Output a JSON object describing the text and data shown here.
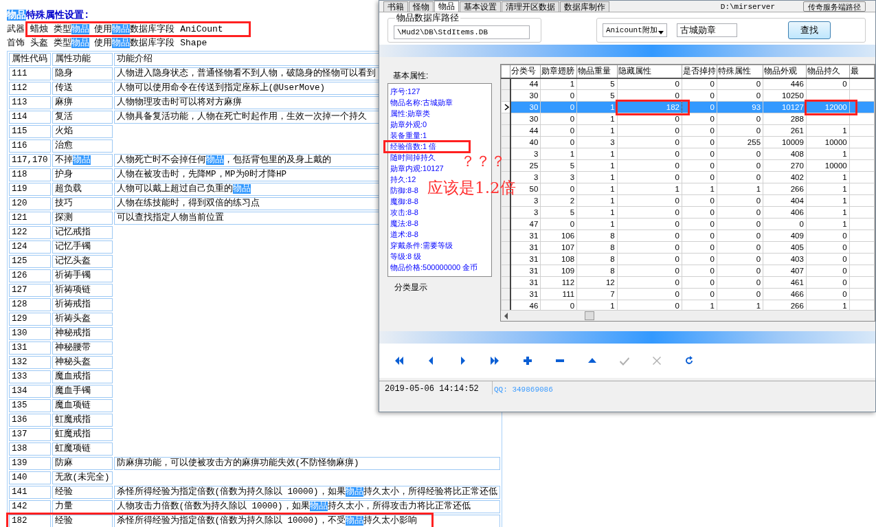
{
  "document": {
    "title": [
      {
        "text": "物品",
        "highlight": true
      },
      {
        "text": "特殊属性设置:"
      }
    ],
    "lines": [
      [
        {
          "text": "武器 蜡烛 类型"
        },
        {
          "text": "物品",
          "highlight": true
        },
        {
          "text": " 使用"
        },
        {
          "text": "物品",
          "highlight": true
        },
        {
          "text": "数据库字段 AniCount"
        }
      ],
      [
        {
          "text": "首饰 头盔 类型"
        },
        {
          "text": "物品",
          "highlight": true
        },
        {
          "text": " 使用"
        },
        {
          "text": "物品",
          "highlight": true
        },
        {
          "text": "数据库字段 Shape"
        }
      ]
    ],
    "table": {
      "columns": [
        "属性代码",
        "属性功能",
        "功能介绍"
      ],
      "rows": [
        {
          "code": "111",
          "function": [
            {
              "text": "隐身"
            }
          ],
          "description": [
            {
              "text": "人物进入隐身状态，普通怪物看不到人物，破隐身的怪物可以看到"
            }
          ]
        },
        {
          "code": "112",
          "function": [
            {
              "text": "传送"
            }
          ],
          "description": [
            {
              "text": "人物可以使用命令在传送到指定座标上(@UserMove)"
            }
          ]
        },
        {
          "code": "113",
          "function": [
            {
              "text": "麻痹"
            }
          ],
          "description": [
            {
              "text": "人物物理攻击时可以将对方麻痹"
            }
          ]
        },
        {
          "code": "114",
          "function": [
            {
              "text": "复活"
            }
          ],
          "description": [
            {
              "text": "人物具备复活功能，人物在死亡时起作用，生效一次掉一个持久"
            }
          ]
        },
        {
          "code": "115",
          "function": [
            {
              "text": "火焰"
            }
          ]
        },
        {
          "code": "116",
          "function": [
            {
              "text": "治愈"
            }
          ]
        },
        {
          "code": "117,170",
          "function": [
            {
              "text": "不掉"
            },
            {
              "text": "物品",
              "highlight": true
            }
          ],
          "description": [
            {
              "text": "人物死亡时不会掉任何"
            },
            {
              "text": "物品",
              "highlight": true
            },
            {
              "text": "，包括背包里的及身上戴的"
            }
          ]
        },
        {
          "code": "118",
          "function": [
            {
              "text": "护身"
            }
          ],
          "description": [
            {
              "text": "人物在被攻击时，先降MP，MP为0时才降HP"
            }
          ]
        },
        {
          "code": "119",
          "function": [
            {
              "text": "超负载"
            }
          ],
          "description": [
            {
              "text": "人物可以戴上超过自己负重的"
            },
            {
              "text": "物品",
              "highlight": true
            }
          ]
        },
        {
          "code": "120",
          "function": [
            {
              "text": "技巧"
            }
          ],
          "description": [
            {
              "text": "人物在练技能时，得到双倍的练习点"
            }
          ]
        },
        {
          "code": "121",
          "function": [
            {
              "text": "探测"
            }
          ],
          "description": [
            {
              "text": "可以查找指定人物当前位置"
            }
          ]
        },
        {
          "code": "122",
          "function": [
            {
              "text": "记忆戒指"
            }
          ]
        },
        {
          "code": "124",
          "function": [
            {
              "text": "记忆手镯"
            }
          ]
        },
        {
          "code": "125",
          "function": [
            {
              "text": "记忆头盔"
            }
          ]
        },
        {
          "code": "126",
          "function": [
            {
              "text": "祈祷手镯"
            }
          ]
        },
        {
          "code": "127",
          "function": [
            {
              "text": "祈祷项链"
            }
          ]
        },
        {
          "code": "128",
          "function": [
            {
              "text": "祈祷戒指"
            }
          ]
        },
        {
          "code": "129",
          "function": [
            {
              "text": "祈祷头盔"
            }
          ]
        },
        {
          "code": "130",
          "function": [
            {
              "text": "神秘戒指"
            }
          ]
        },
        {
          "code": "131",
          "function": [
            {
              "text": "神秘腰带"
            }
          ]
        },
        {
          "code": "132",
          "function": [
            {
              "text": "神秘头盔"
            }
          ]
        },
        {
          "code": "133",
          "function": [
            {
              "text": "魔血戒指"
            }
          ]
        },
        {
          "code": "134",
          "function": [
            {
              "text": "魔血手镯"
            }
          ]
        },
        {
          "code": "135",
          "function": [
            {
              "text": "魔血项链"
            }
          ]
        },
        {
          "code": "136",
          "function": [
            {
              "text": "虹魔戒指"
            }
          ]
        },
        {
          "code": "137",
          "function": [
            {
              "text": "虹魔戒指"
            }
          ]
        },
        {
          "code": "138",
          "function": [
            {
              "text": "虹魔项链"
            }
          ]
        },
        {
          "code": "139",
          "function": [
            {
              "text": "防麻"
            }
          ],
          "description": [
            {
              "text": "防麻痹功能，可以使被攻击方的麻痹功能失效(不防怪物麻痹)"
            }
          ]
        },
        {
          "code": "140",
          "function": [
            {
              "text": "无敌(未完全)"
            }
          ]
        },
        {
          "code": "141",
          "function": [
            {
              "text": "经验"
            }
          ],
          "description": [
            {
              "text": "杀怪所得经验为指定倍数(倍数为持久除以 10000)，如果"
            },
            {
              "text": "物品",
              "highlight": true
            },
            {
              "text": "持久太小，所得经验将比正常还低"
            }
          ]
        },
        {
          "code": "142",
          "function": [
            {
              "text": "力量"
            }
          ],
          "description": [
            {
              "text": "人物攻击力倍数(倍数为持久除以 10000)，如果"
            },
            {
              "text": "物品",
              "highlight": true
            },
            {
              "text": "持久太小，所得攻击力将比正常还低"
            }
          ]
        },
        {
          "code": "182",
          "function": [
            {
              "text": "经验"
            }
          ],
          "description": [
            {
              "text": "杀怪所得经验为指定倍数(倍数为持久除以 10000)，不受"
            },
            {
              "text": "物品",
              "highlight": true
            },
            {
              "text": "持久太小影响"
            }
          ]
        }
      ]
    }
  },
  "window": {
    "tabs": [
      {
        "label": "书籍",
        "selected": false
      },
      {
        "label": "怪物",
        "selected": false
      },
      {
        "label": "物品",
        "selected": true
      },
      {
        "label": "基本设置",
        "selected": false
      },
      {
        "label": "清理开区数据",
        "selected": false
      },
      {
        "label": "数据库制作",
        "selected": false
      }
    ],
    "server_path": "D:\\mirserver",
    "server_path_button": "传奇服务端路径",
    "db_group": {
      "title": "物品数据库路径",
      "path": "\\Mud2\\DB\\StdItems.DB"
    },
    "search": {
      "dropdown": "Anicount附加",
      "value": "古城勋章",
      "button": "查找"
    },
    "basic": {
      "title": "基本属性:",
      "lines": [
        "序号:127",
        "物品名称:古城勋章",
        "属性:勋章类",
        "勋章外观:0",
        "装备重量:1",
        "经验倍数:1 倍",
        "随时间掉持久",
        "勋章内观:10127",
        "持久:12",
        "防御:8-8",
        "魔御:8-8",
        "攻击:8-8",
        "魔法:8-8",
        "道术:8-8",
        "穿戴条件:需要等级",
        "等级:8 级",
        "物品价格:500000000 金币"
      ]
    },
    "category_title": "分类显示",
    "grid": {
      "columns": [
        "分类号",
        "勋章翅膀",
        "物品重量",
        "隐藏属性",
        "是否掉持",
        "特殊属性",
        "物品外观",
        "物品持久",
        "最"
      ],
      "rows": [
        {
          "selected": false,
          "cells": [
            "44",
            "1",
            "5",
            "0",
            "0",
            "0",
            "446",
            "0"
          ]
        },
        {
          "selected": false,
          "cells": [
            "30",
            "0",
            "5",
            "0",
            "0",
            "0",
            "10250",
            null
          ]
        },
        {
          "selected": true,
          "cells": [
            "30",
            "0",
            "1",
            "182",
            "0",
            "93",
            "10127",
            "12000"
          ]
        },
        {
          "selected": false,
          "cells": [
            "30",
            "0",
            "1",
            "0",
            "0",
            "0",
            "288",
            null
          ]
        },
        {
          "selected": false,
          "cells": [
            "44",
            "0",
            "1",
            "0",
            "0",
            "0",
            "261",
            "1"
          ]
        },
        {
          "selected": false,
          "cells": [
            "40",
            "0",
            "3",
            "0",
            "0",
            "255",
            "10009",
            "10000"
          ]
        },
        {
          "selected": false,
          "cells": [
            "3",
            "1",
            "1",
            "0",
            "0",
            "0",
            "408",
            "1"
          ]
        },
        {
          "selected": false,
          "cells": [
            "25",
            "5",
            "1",
            "0",
            "0",
            "0",
            "270",
            "10000"
          ]
        },
        {
          "selected": false,
          "cells": [
            "3",
            "3",
            "1",
            "0",
            "0",
            "0",
            "402",
            "1"
          ]
        },
        {
          "selected": false,
          "cells": [
            "50",
            "0",
            "1",
            "1",
            "1",
            "1",
            "266",
            "1"
          ]
        },
        {
          "selected": false,
          "cells": [
            "3",
            "2",
            "1",
            "0",
            "0",
            "0",
            "404",
            "1"
          ]
        },
        {
          "selected": false,
          "cells": [
            "3",
            "5",
            "1",
            "0",
            "0",
            "0",
            "406",
            "1"
          ]
        },
        {
          "selected": false,
          "cells": [
            "47",
            "0",
            "1",
            "0",
            "0",
            "0",
            "0",
            "1"
          ]
        },
        {
          "selected": false,
          "cells": [
            "31",
            "106",
            "8",
            "0",
            "0",
            "0",
            "409",
            "0"
          ]
        },
        {
          "selected": false,
          "cells": [
            "31",
            "107",
            "8",
            "0",
            "0",
            "0",
            "405",
            "0"
          ]
        },
        {
          "selected": false,
          "cells": [
            "31",
            "108",
            "8",
            "0",
            "0",
            "0",
            "403",
            "0"
          ]
        },
        {
          "selected": false,
          "cells": [
            "31",
            "109",
            "8",
            "0",
            "0",
            "0",
            "407",
            "0"
          ]
        },
        {
          "selected": false,
          "cells": [
            "31",
            "112",
            "12",
            "0",
            "0",
            "0",
            "461",
            "0"
          ]
        },
        {
          "selected": false,
          "cells": [
            "31",
            "111",
            "7",
            "0",
            "0",
            "0",
            "466",
            "0"
          ]
        },
        {
          "selected": false,
          "cells": [
            "46",
            "0",
            "1",
            "0",
            "1",
            "1",
            "266",
            "1"
          ]
        }
      ]
    },
    "toolbar": [
      {
        "kind": "first",
        "disabled": false
      },
      {
        "kind": "prior",
        "disabled": false
      },
      {
        "kind": "next",
        "disabled": false
      },
      {
        "kind": "last",
        "disabled": false
      },
      {
        "kind": "insert",
        "disabled": false
      },
      {
        "kind": "delete",
        "disabled": false
      },
      {
        "kind": "edit",
        "disabled": false
      },
      {
        "kind": "post",
        "disabled": true
      },
      {
        "kind": "cancel",
        "disabled": true
      },
      {
        "kind": "refresh",
        "disabled": false
      }
    ],
    "status_bar": {
      "datetime": "2019-05-06 14:14:52",
      "contact": "QQ: 349869086"
    }
  },
  "annotations": {
    "question_marks": "？？？",
    "note": "应该是1.2倍"
  }
}
